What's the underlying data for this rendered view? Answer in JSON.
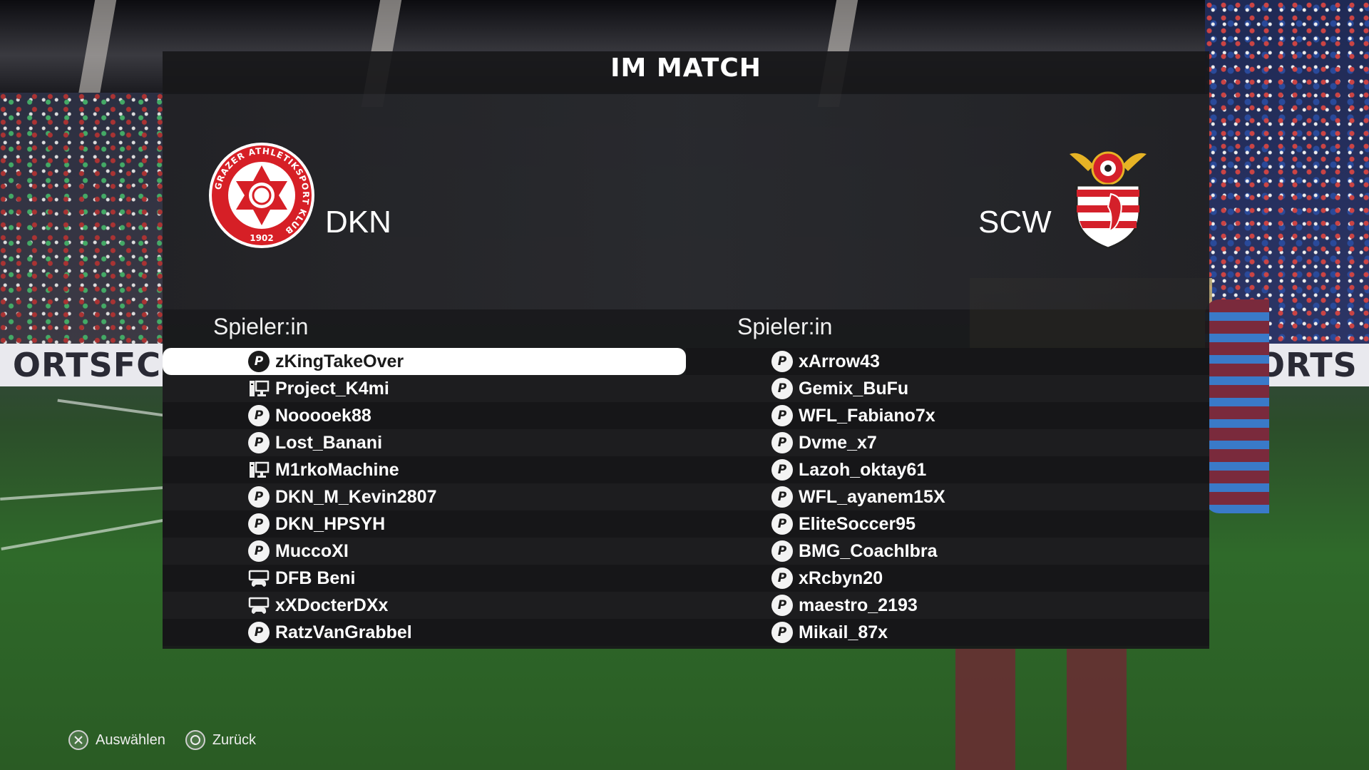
{
  "screen": {
    "title": "IM MATCH"
  },
  "home": {
    "abbr": "DKN",
    "column_header": "Spieler:in",
    "crest": {
      "icon": "gak-crest",
      "ring_text": "GRAZER ATHLETIKSPORT KLUB",
      "year": "1902",
      "color": "#d61f26"
    },
    "players": [
      {
        "name": "zKingTakeOver",
        "platform": "ps-icon",
        "selected": true
      },
      {
        "name": "Project_K4mi",
        "platform": "pc-icon"
      },
      {
        "name": "Nooooek88",
        "platform": "ps-icon"
      },
      {
        "name": "Lost_Banani",
        "platform": "ps-icon"
      },
      {
        "name": "M1rkoMachine",
        "platform": "pc-icon"
      },
      {
        "name": "DKN_M_Kevin2807",
        "platform": "ps-icon"
      },
      {
        "name": "DKN_HPSYH",
        "platform": "ps-icon"
      },
      {
        "name": "MuccoXI",
        "platform": "ps-icon"
      },
      {
        "name": "DFB Beni",
        "platform": "xbox-icon"
      },
      {
        "name": "xXDocterDXx",
        "platform": "xbox-icon"
      },
      {
        "name": "RatzVanGrabbel",
        "platform": "ps-icon"
      }
    ]
  },
  "away": {
    "abbr": "SCW",
    "column_header": "Spieler:in",
    "crest": {
      "icon": "winged-shield-crest",
      "color": "#d4202a"
    },
    "players": [
      {
        "name": "xArrow43",
        "platform": "ps-icon"
      },
      {
        "name": "Gemix_BuFu",
        "platform": "ps-icon"
      },
      {
        "name": "WFL_Fabiano7x",
        "platform": "ps-icon"
      },
      {
        "name": "Dvme_x7",
        "platform": "ps-icon"
      },
      {
        "name": "Lazoh_oktay61",
        "platform": "ps-icon"
      },
      {
        "name": "WFL_ayanem15X",
        "platform": "ps-icon"
      },
      {
        "name": "EliteSoccer95",
        "platform": "ps-icon"
      },
      {
        "name": "BMG_CoachIbra",
        "platform": "ps-icon"
      },
      {
        "name": "xRcbyn20",
        "platform": "ps-icon"
      },
      {
        "name": "maestro_2193",
        "platform": "ps-icon"
      },
      {
        "name": "Mikail_87x",
        "platform": "ps-icon"
      }
    ]
  },
  "background": {
    "boards_left": "ORTSFC",
    "boards_right": "SPORTS"
  },
  "footer": {
    "select": {
      "icon": "cross-button-icon",
      "label": "Auswählen"
    },
    "back": {
      "icon": "circle-button-icon",
      "label": "Zurück"
    }
  }
}
